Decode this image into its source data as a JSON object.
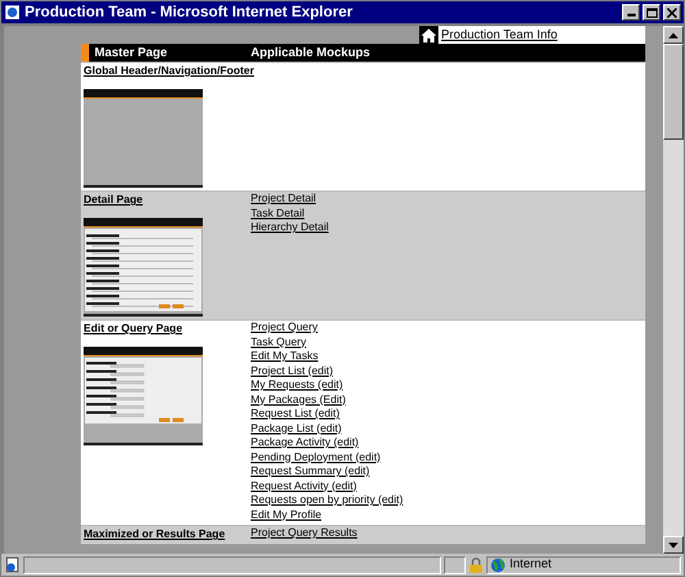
{
  "window": {
    "title": "Production Team - Microsoft Internet Explorer"
  },
  "header_link": "Production Team Info",
  "table": {
    "columns": [
      "Master Page",
      "Applicable Mockups"
    ],
    "rows": [
      {
        "master": "Global Header/Navigation/Footer",
        "thumbnail": {
          "kind": "blank"
        },
        "mockups": []
      },
      {
        "master": "Detail Page",
        "thumbnail": {
          "kind": "detail"
        },
        "mockups": [
          "Project Detail",
          "Task Detail",
          "Hierarchy Detail"
        ]
      },
      {
        "master": "Edit or Query Page",
        "thumbnail": {
          "kind": "form"
        },
        "mockups": [
          "Project Query",
          "Task Query",
          "Edit My Tasks",
          "Project List (edit)",
          "My Requests (edit)",
          "My Packages (Edit)",
          "Request List (edit)",
          "Package List (edit)",
          "Package Activity (edit)",
          "Pending Deployment (edit)",
          "Request Summary (edit)",
          "Request Activity (edit)",
          "Requests open by priority (edit)",
          "Edit My Profile"
        ]
      },
      {
        "master": "Maximized or Results Page",
        "mockups": [
          "Project Query Results"
        ]
      }
    ]
  },
  "status_bar": {
    "zone": "Internet"
  }
}
